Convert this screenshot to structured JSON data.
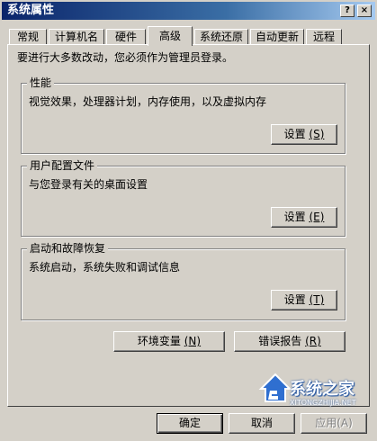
{
  "window": {
    "title": "系统属性",
    "help_glyph": "?",
    "close_glyph": "×"
  },
  "tabs": [
    {
      "label": "常规"
    },
    {
      "label": "计算机名"
    },
    {
      "label": "硬件"
    },
    {
      "label": "高级",
      "active": true
    },
    {
      "label": "系统还原"
    },
    {
      "label": "自动更新"
    },
    {
      "label": "远程"
    }
  ],
  "note": "要进行大多数改动，您必须作为管理员登录。",
  "groups": {
    "performance": {
      "legend": "性能",
      "desc": "视觉效果，处理器计划，内存使用，以及虚拟内存",
      "button_text": "设置",
      "button_key": "(S)"
    },
    "profiles": {
      "legend": "用户配置文件",
      "desc": "与您登录有关的桌面设置",
      "button_text": "设置",
      "button_key": "(E)"
    },
    "startup": {
      "legend": "启动和故障恢复",
      "desc": "系统启动，系统失败和调试信息",
      "button_text": "设置",
      "button_key": "(T)"
    }
  },
  "env_button": {
    "text": "环境变量",
    "key": "(N)"
  },
  "error_button": {
    "text": "错误报告",
    "key": "(R)"
  },
  "footer": {
    "ok": "确定",
    "cancel": "取消",
    "apply": "应用(A)"
  },
  "watermark": {
    "name": "系统之家",
    "url": "XITONGZHIJIA.NET"
  },
  "colors": {
    "face": "#d4d0c8",
    "title_start": "#0a246a",
    "title_end": "#a6caf0",
    "watermark_blue": "#1c4f9e"
  }
}
